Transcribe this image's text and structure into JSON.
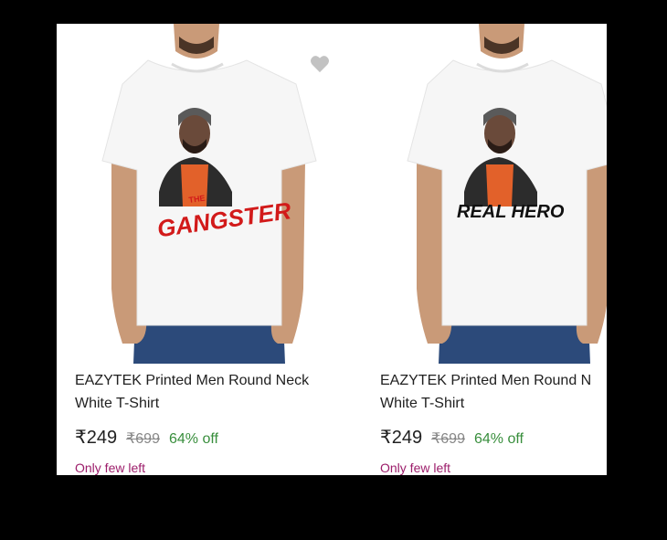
{
  "products": [
    {
      "title_line1": "EAZYTEK Printed Men Round Neck",
      "title_line2": "White T-Shirt",
      "price": "₹249",
      "mrp": "₹699",
      "discount": "64% off",
      "stock_label": "Only few left",
      "print_text": "GANGSTER",
      "print_text_small": "THE",
      "print_color": "#d21a1a"
    },
    {
      "title_line1": "EAZYTEK Printed Men Round N",
      "title_line2": "White T-Shirt",
      "price": "₹249",
      "mrp": "₹699",
      "discount": "64% off",
      "stock_label": "Only few left",
      "print_text": "REAL HERO",
      "print_color": "#111111"
    }
  ],
  "icons": {
    "wishlist": "heart-icon"
  },
  "colors": {
    "price_discount": "#388e3c",
    "stock_warning": "#9c1d6a",
    "wishlist_icon": "#c2c2c2"
  }
}
